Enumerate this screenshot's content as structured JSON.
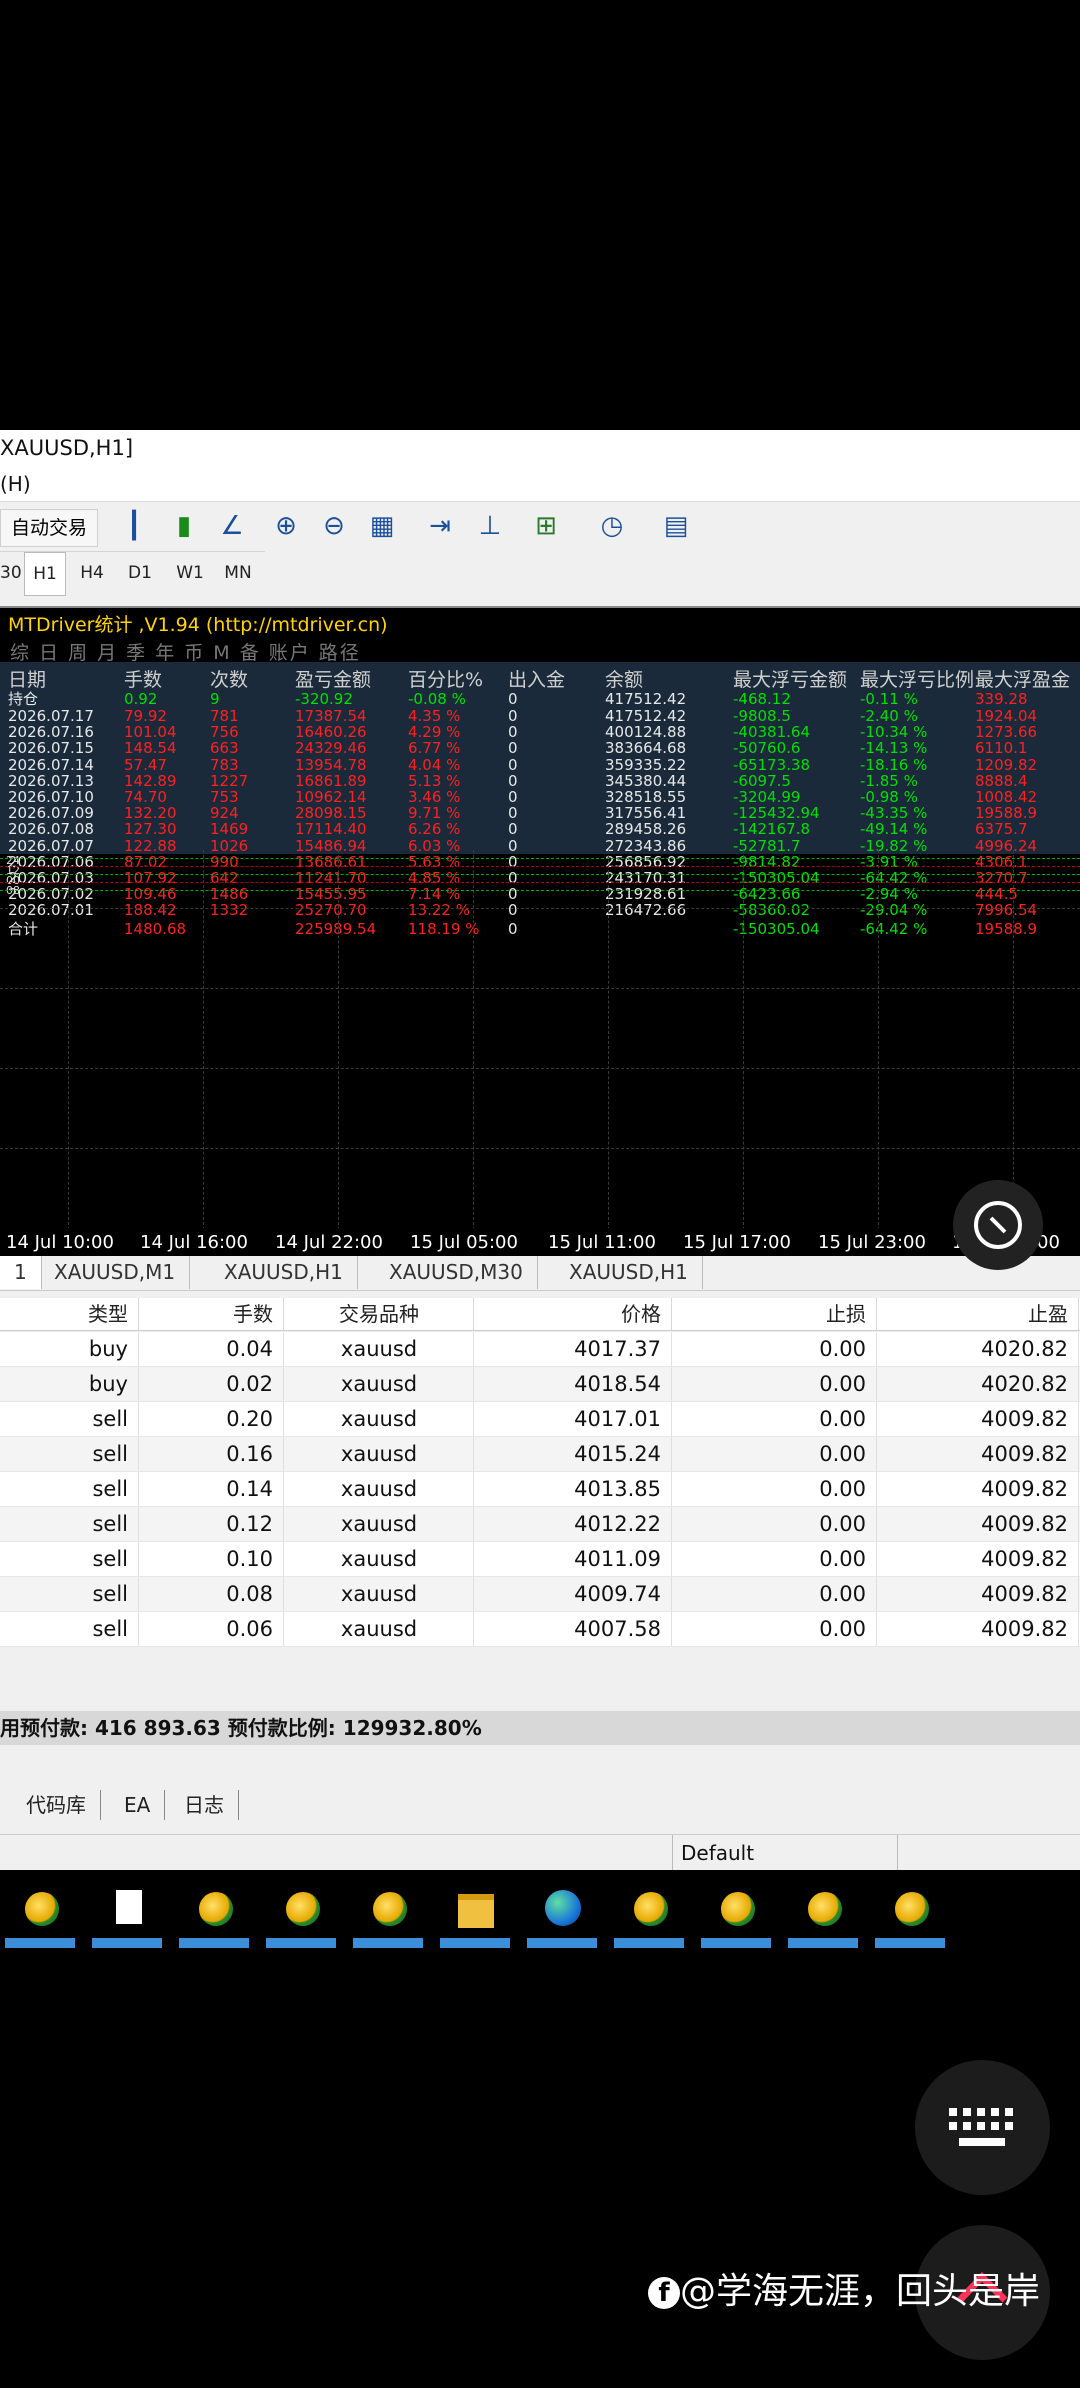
{
  "window": {
    "title": "XAUUSD,H1]",
    "menu_fragment": "(H)"
  },
  "toolbar": {
    "autotrade_label": "自动交易"
  },
  "timeframes": [
    "30",
    "H1",
    "H4",
    "D1",
    "W1",
    "MN"
  ],
  "active_timeframe": "H1",
  "indicator": {
    "title": "MTDriver统计 ,V1.94 (http://mtdriver.cn)",
    "tabs": "综 日 周 月 季 年 币 M 备 账户 路径",
    "headers": [
      "日期",
      "手数",
      "次数",
      "盈亏金额",
      "百分比%",
      "出入金",
      "余额",
      "最大浮亏金额",
      "最大浮亏比例",
      "最大浮盈金"
    ],
    "holding": {
      "label": "持仓",
      "lots": "0.92",
      "count": "9",
      "pnl": "-320.92",
      "pct": "-0.08 %",
      "flow": "0",
      "balance": "417512.42",
      "max_loss": "-468.12",
      "max_loss_pct": "-0.11 %",
      "max_profit": "339.28"
    },
    "rows": [
      {
        "date": "2026.07.17",
        "lots": "79.92",
        "count": "781",
        "pnl": "17387.54",
        "pct": "4.35 %",
        "flow": "0",
        "balance": "417512.42",
        "max_loss": "-9808.5",
        "max_loss_pct": "-2.40 %",
        "max_profit": "1924.04"
      },
      {
        "date": "2026.07.16",
        "lots": "101.04",
        "count": "756",
        "pnl": "16460.26",
        "pct": "4.29 %",
        "flow": "0",
        "balance": "400124.88",
        "max_loss": "-40381.64",
        "max_loss_pct": "-10.34 %",
        "max_profit": "1273.66"
      },
      {
        "date": "2026.07.15",
        "lots": "148.54",
        "count": "663",
        "pnl": "24329.46",
        "pct": "6.77 %",
        "flow": "0",
        "balance": "383664.68",
        "max_loss": "-50760.6",
        "max_loss_pct": "-14.13 %",
        "max_profit": "6110.1"
      },
      {
        "date": "2026.07.14",
        "lots": "57.47",
        "count": "783",
        "pnl": "13954.78",
        "pct": "4.04 %",
        "flow": "0",
        "balance": "359335.22",
        "max_loss": "-65173.38",
        "max_loss_pct": "-18.16 %",
        "max_profit": "1209.82"
      },
      {
        "date": "2026.07.13",
        "lots": "142.89",
        "count": "1227",
        "pnl": "16861.89",
        "pct": "5.13 %",
        "flow": "0",
        "balance": "345380.44",
        "max_loss": "-6097.5",
        "max_loss_pct": "-1.85 %",
        "max_profit": "8888.4"
      },
      {
        "date": "2026.07.10",
        "lots": "74.70",
        "count": "753",
        "pnl": "10962.14",
        "pct": "3.46 %",
        "flow": "0",
        "balance": "328518.55",
        "max_loss": "-3204.99",
        "max_loss_pct": "-0.98 %",
        "max_profit": "1008.42"
      },
      {
        "date": "2026.07.09",
        "lots": "132.20",
        "count": "924",
        "pnl": "28098.15",
        "pct": "9.71 %",
        "flow": "0",
        "balance": "317556.41",
        "max_loss": "-125432.94",
        "max_loss_pct": "-43.35 %",
        "max_profit": "19588.9"
      },
      {
        "date": "2026.07.08",
        "lots": "127.30",
        "count": "1469",
        "pnl": "17114.40",
        "pct": "6.26 %",
        "flow": "0",
        "balance": "289458.26",
        "max_loss": "-142167.8",
        "max_loss_pct": "-49.14 %",
        "max_profit": "6375.7"
      },
      {
        "date": "2026.07.07",
        "lots": "122.88",
        "count": "1026",
        "pnl": "15486.94",
        "pct": "6.03 %",
        "flow": "0",
        "balance": "272343.86",
        "max_loss": "-52781.7",
        "max_loss_pct": "-19.82 %",
        "max_profit": "4996.24"
      },
      {
        "date": "2026.07.06",
        "lots": "87.02",
        "count": "990",
        "pnl": "13686.61",
        "pct": "5.63 %",
        "flow": "0",
        "balance": "256856.92",
        "max_loss": "-9814.82",
        "max_loss_pct": "-3.91 %",
        "max_profit": "4306.1"
      },
      {
        "date": "2026.07.03",
        "lots": "107.92",
        "count": "642",
        "pnl": "11241.70",
        "pct": "4.85 %",
        "flow": "0",
        "balance": "243170.31",
        "max_loss": "-150305.04",
        "max_loss_pct": "-64.42 %",
        "max_profit": "3270.7"
      },
      {
        "date": "2026.07.02",
        "lots": "109.46",
        "count": "1486",
        "pnl": "15455.95",
        "pct": "7.14 %",
        "flow": "0",
        "balance": "231928.61",
        "max_loss": "-6423.66",
        "max_loss_pct": "-2.94 %",
        "max_profit": "444.5"
      },
      {
        "date": "2026.07.01",
        "lots": "188.42",
        "count": "1332",
        "pnl": "25270.70",
        "pct": "13.22 %",
        "flow": "0",
        "balance": "216472.66",
        "max_loss": "-58360.02",
        "max_loss_pct": "-29.04 %",
        "max_profit": "7996.54"
      }
    ],
    "total": {
      "label": "合计",
      "lots": "1480.68",
      "pnl": "225989.54",
      "pct": "118.19 %",
      "flow": "0",
      "max_loss": "-150305.04",
      "max_loss_pct": "-64.42 %",
      "max_profit": "19588.9"
    },
    "mini_levels": [
      "24",
      "12",
      "00",
      "08"
    ]
  },
  "time_axis": [
    "14 Jul 10:00",
    "14 Jul 16:00",
    "14 Jul 22:00",
    "15 Jul 05:00",
    "15 Jul 11:00",
    "15 Jul 17:00",
    "15 Jul 23:00",
    "16 Jul 06:00"
  ],
  "chart_tabs": [
    "1",
    "XAUUSD,M1",
    "XAUUSD,H1",
    "XAUUSD,M30",
    "XAUUSD,H1"
  ],
  "orders": {
    "headers": [
      "类型",
      "手数",
      "交易品种",
      "价格",
      "止损",
      "止盈"
    ],
    "rows": [
      {
        "type": "buy",
        "lots": "0.04",
        "symbol": "xauusd",
        "price": "4017.37",
        "sl": "0.00",
        "tp": "4020.82"
      },
      {
        "type": "buy",
        "lots": "0.02",
        "symbol": "xauusd",
        "price": "4018.54",
        "sl": "0.00",
        "tp": "4020.82"
      },
      {
        "type": "sell",
        "lots": "0.20",
        "symbol": "xauusd",
        "price": "4017.01",
        "sl": "0.00",
        "tp": "4009.82"
      },
      {
        "type": "sell",
        "lots": "0.16",
        "symbol": "xauusd",
        "price": "4015.24",
        "sl": "0.00",
        "tp": "4009.82"
      },
      {
        "type": "sell",
        "lots": "0.14",
        "symbol": "xauusd",
        "price": "4013.85",
        "sl": "0.00",
        "tp": "4009.82"
      },
      {
        "type": "sell",
        "lots": "0.12",
        "symbol": "xauusd",
        "price": "4012.22",
        "sl": "0.00",
        "tp": "4009.82"
      },
      {
        "type": "sell",
        "lots": "0.10",
        "symbol": "xauusd",
        "price": "4011.09",
        "sl": "0.00",
        "tp": "4009.82"
      },
      {
        "type": "sell",
        "lots": "0.08",
        "symbol": "xauusd",
        "price": "4009.74",
        "sl": "0.00",
        "tp": "4009.82"
      },
      {
        "type": "sell",
        "lots": "0.06",
        "symbol": "xauusd",
        "price": "4007.58",
        "sl": "0.00",
        "tp": "4009.82"
      }
    ],
    "summary": "用预付款: 416 893.63  预付款比例: 129932.80%"
  },
  "bottom_tabs": [
    "代码库",
    "EA",
    "日志"
  ],
  "status": {
    "profile": "Default"
  },
  "watermark": "@学海无涯，回头是岸",
  "colors": {
    "profit": "#00e000",
    "loss": "#ff2020",
    "panel_bg": "#1a2a3a",
    "title": "#ffd400"
  }
}
